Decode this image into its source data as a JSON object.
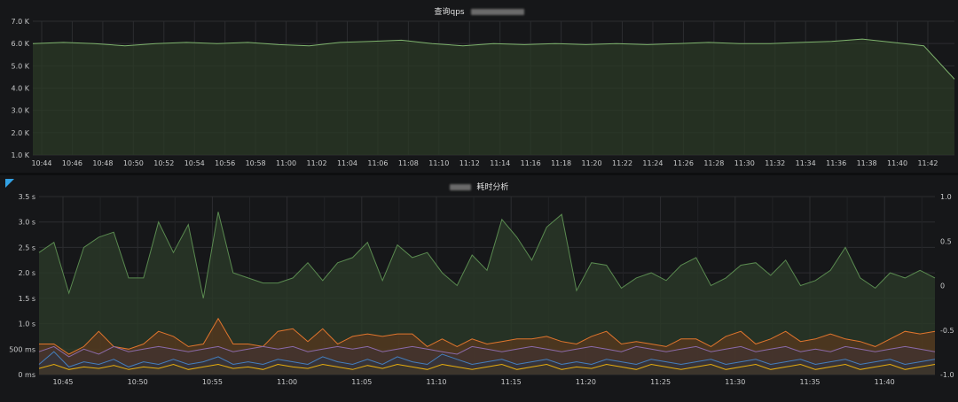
{
  "top_panel": {
    "title": "查询qps",
    "title_masked_text": "",
    "colors": {
      "line": "#7eb26d",
      "fill": "#2b3a26",
      "grid": "#2c2d30"
    }
  },
  "bottom_panel": {
    "title": "耗时分析",
    "title_masked_text": "",
    "corner_marker": "panel-link-corner",
    "colors": {
      "green": "#5e8f53",
      "orange": "#e0752d",
      "grid": "#2c2d30"
    }
  },
  "chart_data": [
    {
      "type": "area",
      "title": "查询qps",
      "x": [
        "10:44",
        "10:46",
        "10:48",
        "10:50",
        "10:52",
        "10:54",
        "10:56",
        "10:58",
        "11:00",
        "11:02",
        "11:04",
        "11:06",
        "11:08",
        "11:10",
        "11:12",
        "11:14",
        "11:16",
        "11:18",
        "11:20",
        "11:22",
        "11:24",
        "11:26",
        "11:28",
        "11:30",
        "11:32",
        "11:34",
        "11:36",
        "11:38",
        "11:40",
        "11:42"
      ],
      "x_tick_labels": [
        "10:44",
        "10:46",
        "10:48",
        "10:50",
        "10:52",
        "10:54",
        "10:56",
        "10:58",
        "11:00",
        "11:02",
        "11:04",
        "11:06",
        "11:08",
        "11:10",
        "11:12",
        "11:14",
        "11:16",
        "11:18",
        "11:20",
        "11:22",
        "11:24",
        "11:26",
        "11:28",
        "11:30",
        "11:32",
        "11:34",
        "11:36",
        "11:38",
        "11:40",
        "11:42"
      ],
      "y_tick_labels": [
        "1.0 K",
        "2.0 K",
        "3.0 K",
        "4.0 K",
        "5.0 K",
        "6.0 K",
        "7.0 K"
      ],
      "ylim": [
        1000,
        7000
      ],
      "series": [
        {
          "values": [
            6000,
            6050,
            6000,
            5900,
            6000,
            6050,
            6000,
            6050,
            5950,
            5900,
            6050,
            6100,
            6150,
            6000,
            5900,
            6000,
            5950,
            6000,
            5950,
            6000,
            5950,
            6000,
            6050,
            6000,
            6000,
            6050,
            6100,
            6200,
            6050,
            5900,
            4400
          ]
        }
      ],
      "grid": true
    },
    {
      "type": "area",
      "title": "耗时分析",
      "x_tick_labels": [
        "10:45",
        "10:50",
        "10:55",
        "11:00",
        "11:05",
        "11:10",
        "11:15",
        "11:20",
        "11:25",
        "11:30",
        "11:35",
        "11:40"
      ],
      "y_tick_labels": [
        "0 ms",
        "500 ms",
        "1.0 s",
        "1.5 s",
        "2.0 s",
        "2.5 s",
        "3.0 s",
        "3.5 s"
      ],
      "y2_tick_labels": [
        "1.0",
        "0.5",
        "0",
        "-0.5",
        "-1.0"
      ],
      "ylim": [
        0,
        3.5
      ],
      "y2lim": [
        -1.0,
        1.0
      ],
      "series": [
        {
          "values": [
            2.4,
            2.6,
            1.6,
            2.5,
            2.7,
            2.8,
            1.9,
            1.9,
            3.0,
            2.4,
            2.95,
            1.5,
            3.2,
            2.0,
            1.9,
            1.8,
            1.8,
            1.9,
            2.2,
            1.85,
            2.2,
            2.3,
            2.6,
            1.85,
            2.55,
            2.3,
            2.4,
            2.0,
            1.75,
            2.35,
            2.05,
            3.05,
            2.7,
            2.25,
            2.9,
            3.15,
            1.65,
            2.2,
            2.15,
            1.7,
            1.9,
            2.0,
            1.85,
            2.15,
            2.3,
            1.75,
            1.9,
            2.15,
            2.2,
            1.95,
            2.25,
            1.75,
            1.85,
            2.05,
            2.5,
            1.9,
            1.7,
            2.0,
            1.9,
            2.05,
            1.9
          ]
        },
        {
          "values": [
            0.6,
            0.6,
            0.4,
            0.55,
            0.85,
            0.55,
            0.5,
            0.6,
            0.85,
            0.75,
            0.55,
            0.6,
            1.1,
            0.6,
            0.6,
            0.55,
            0.85,
            0.9,
            0.65,
            0.9,
            0.6,
            0.75,
            0.8,
            0.75,
            0.8,
            0.8,
            0.55,
            0.7,
            0.55,
            0.7,
            0.6,
            0.65,
            0.7,
            0.7,
            0.75,
            0.65,
            0.6,
            0.75,
            0.85,
            0.6,
            0.65,
            0.6,
            0.55,
            0.7,
            0.7,
            0.55,
            0.75,
            0.85,
            0.6,
            0.7,
            0.85,
            0.65,
            0.7,
            0.8,
            0.7,
            0.65,
            0.55,
            0.7,
            0.85,
            0.8,
            0.85
          ]
        },
        {
          "values": [
            0.45,
            0.55,
            0.35,
            0.5,
            0.4,
            0.55,
            0.45,
            0.5,
            0.55,
            0.5,
            0.45,
            0.5,
            0.55,
            0.45,
            0.5,
            0.55,
            0.5,
            0.55,
            0.45,
            0.5,
            0.55,
            0.5,
            0.55,
            0.45,
            0.5,
            0.55,
            0.5,
            0.45,
            0.4,
            0.55,
            0.5,
            0.45,
            0.5,
            0.55,
            0.5,
            0.45,
            0.5,
            0.55,
            0.5,
            0.45,
            0.55,
            0.5,
            0.45,
            0.5,
            0.55,
            0.45,
            0.5,
            0.55,
            0.45,
            0.5,
            0.55,
            0.45,
            0.5,
            0.45,
            0.55,
            0.5,
            0.45,
            0.5,
            0.55,
            0.5,
            0.45
          ]
        },
        {
          "values": [
            0.2,
            0.45,
            0.15,
            0.25,
            0.2,
            0.3,
            0.15,
            0.25,
            0.2,
            0.3,
            0.2,
            0.25,
            0.35,
            0.2,
            0.25,
            0.2,
            0.3,
            0.25,
            0.2,
            0.35,
            0.25,
            0.2,
            0.3,
            0.2,
            0.35,
            0.25,
            0.2,
            0.4,
            0.3,
            0.2,
            0.25,
            0.3,
            0.2,
            0.25,
            0.3,
            0.2,
            0.25,
            0.2,
            0.3,
            0.25,
            0.2,
            0.3,
            0.25,
            0.2,
            0.25,
            0.3,
            0.2,
            0.25,
            0.3,
            0.2,
            0.25,
            0.3,
            0.2,
            0.25,
            0.3,
            0.2,
            0.25,
            0.3,
            0.2,
            0.25,
            0.3
          ]
        },
        {
          "values": [
            0.12,
            0.2,
            0.1,
            0.15,
            0.12,
            0.18,
            0.1,
            0.15,
            0.12,
            0.2,
            0.1,
            0.15,
            0.2,
            0.12,
            0.15,
            0.1,
            0.2,
            0.15,
            0.12,
            0.2,
            0.15,
            0.1,
            0.18,
            0.12,
            0.2,
            0.15,
            0.1,
            0.2,
            0.15,
            0.1,
            0.15,
            0.2,
            0.1,
            0.15,
            0.2,
            0.1,
            0.15,
            0.12,
            0.2,
            0.15,
            0.1,
            0.2,
            0.15,
            0.1,
            0.15,
            0.2,
            0.1,
            0.15,
            0.2,
            0.1,
            0.15,
            0.2,
            0.1,
            0.15,
            0.2,
            0.1,
            0.15,
            0.2,
            0.1,
            0.15,
            0.2
          ]
        }
      ],
      "grid": true
    }
  ]
}
